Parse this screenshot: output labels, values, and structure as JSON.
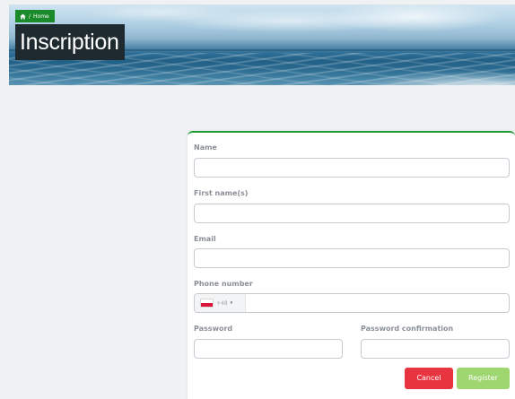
{
  "breadcrumb": {
    "home_icon": "home-icon",
    "separator": "/",
    "label": "Home"
  },
  "page": {
    "title": "Inscription"
  },
  "form": {
    "name_label": "Name",
    "first_names_label": "First name(s)",
    "email_label": "Email",
    "phone_label": "Phone number",
    "phone_flag_icon": "poland-flag-icon",
    "phone_dial_code": "+48",
    "phone_caret": "▾",
    "password_label": "Password",
    "password_confirmation_label": "Password confirmation",
    "cancel_label": "Cancel",
    "register_label": "Register"
  },
  "colors": {
    "breadcrumb_bg": "#1a8a2a",
    "title_bg": "#1f2a30",
    "card_top_border": "#1f9a34",
    "cancel": "#e8343f",
    "register": "#9fd66f"
  }
}
